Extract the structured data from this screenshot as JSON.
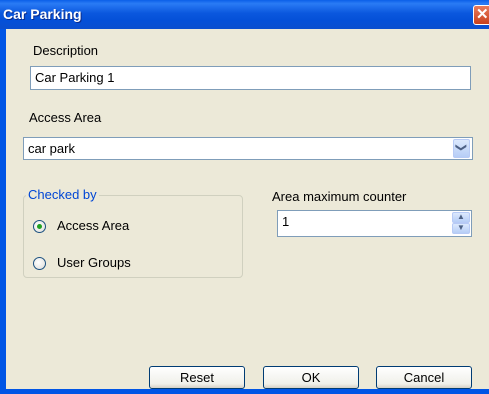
{
  "window": {
    "title": "Car Parking",
    "close_glyph": "✕"
  },
  "description": {
    "label": "Description",
    "value": "Car Parking 1"
  },
  "access_area": {
    "label": "Access Area",
    "value": "car park",
    "dropdown_glyph": "❯"
  },
  "checked_by": {
    "legend": "Checked by",
    "options": [
      {
        "label": "Access Area",
        "selected": true
      },
      {
        "label": "User Groups",
        "selected": false
      }
    ]
  },
  "area_max_counter": {
    "label": "Area maximum counter",
    "value": "1"
  },
  "buttons": {
    "reset": "Reset",
    "ok": "OK",
    "cancel": "Cancel"
  },
  "colors": {
    "titlebar": "#0055e5",
    "dialog_bg": "#ece9d8",
    "legend_text": "#0046d5",
    "radio_selected": "#21a121"
  }
}
